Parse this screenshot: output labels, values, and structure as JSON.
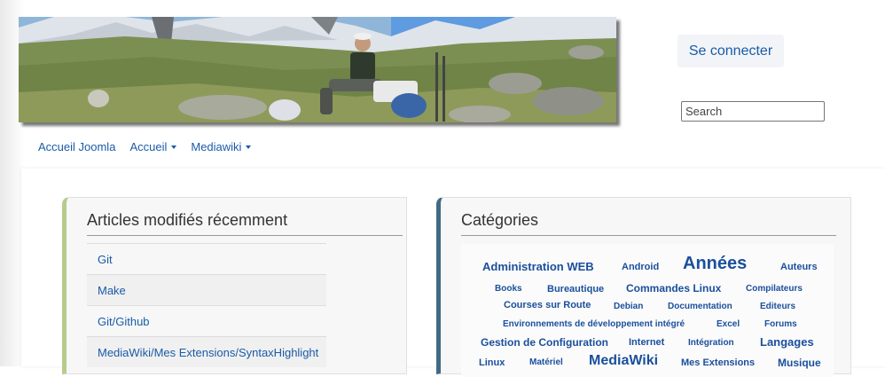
{
  "header": {
    "banner_alt": "mountain hiker banner",
    "login_label": "Se connecter",
    "search_placeholder": "Search"
  },
  "nav": {
    "items": [
      {
        "label": "Accueil Joomla",
        "dropdown": false
      },
      {
        "label": "Accueil",
        "dropdown": true
      },
      {
        "label": "Mediawiki",
        "dropdown": true
      }
    ]
  },
  "articles_panel": {
    "title": "Articles modifiés récemment",
    "accent": "#b5cc8f",
    "items": [
      "Git",
      "Make",
      "Git/Github",
      "MediaWiki/Mes Extensions/SyntaxHighlight"
    ]
  },
  "categories_panel": {
    "title": "Catégories",
    "accent": "#416b84",
    "tags": {
      "administration_web": "Administration WEB",
      "android": "Android",
      "annees": "Années",
      "auteurs": "Auteurs",
      "books": "Books",
      "bureautique": "Bureautique",
      "commandes_linux": "Commandes Linux",
      "compilateurs": "Compilateurs",
      "courses_sur_route": "Courses sur Route",
      "debian": "Debian",
      "documentation": "Documentation",
      "editeurs": "Editeurs",
      "environnements": "Environnements de développement intégré",
      "excel": "Excel",
      "forums": "Forums",
      "gestion_configuration": "Gestion de Configuration",
      "internet": "Internet",
      "integration": "Intégration",
      "langages": "Langages",
      "linux": "Linux",
      "materiel": "Matériel",
      "mediawiki": "MediaWiki",
      "mes_extensions": "Mes Extensions",
      "musique": "Musique"
    }
  }
}
